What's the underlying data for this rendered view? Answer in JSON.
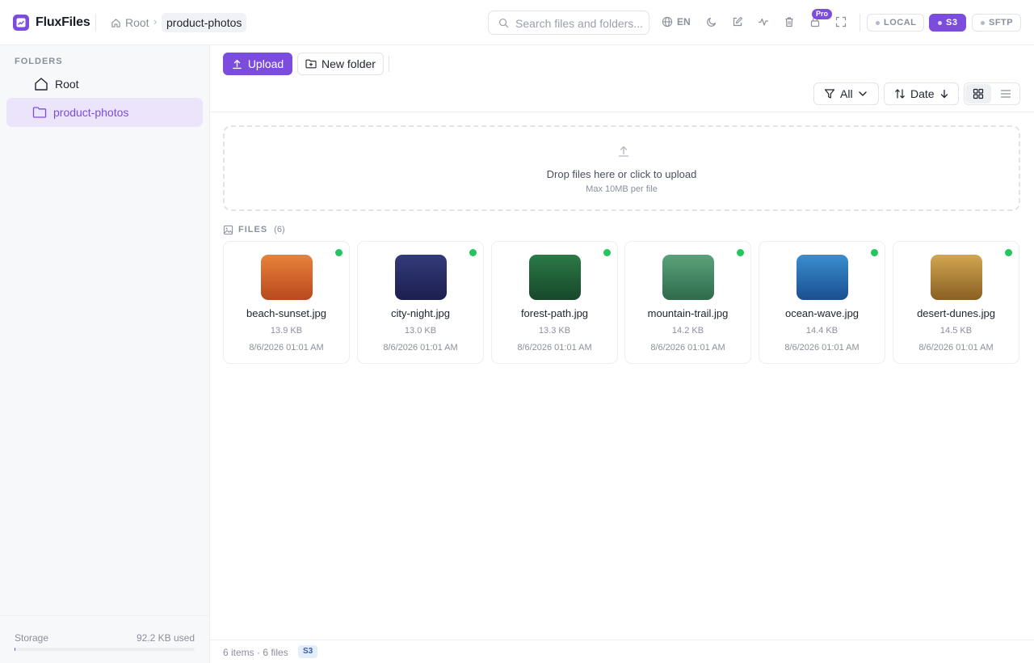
{
  "app": {
    "name": "FluxFiles",
    "accent": "#7c4ddc"
  },
  "breadcrumb": {
    "root": "Root",
    "current": "product-photos"
  },
  "search": {
    "placeholder": "Search files and folders..."
  },
  "header": {
    "language": "EN",
    "pro_badge": "Pro",
    "icons": [
      "globe-icon",
      "moon-icon",
      "edit-icon",
      "activity-icon",
      "trash-icon",
      "lock-icon",
      "fullscreen-icon"
    ],
    "storage_tabs": [
      {
        "label": "LOCAL",
        "active": false
      },
      {
        "label": "S3",
        "active": true
      },
      {
        "label": "SFTP",
        "active": false
      }
    ]
  },
  "sidebar": {
    "heading": "FOLDERS",
    "items": [
      {
        "label": "Root",
        "icon": "home-icon",
        "selected": false
      },
      {
        "label": "product-photos",
        "icon": "folder-icon",
        "selected": true
      }
    ],
    "storage_label": "Storage",
    "storage_used": "92.2 KB used",
    "storage_fill_fraction": 0.001
  },
  "toolbar": {
    "upload_label": "Upload",
    "new_folder_label": "New folder",
    "filter_label": "All",
    "sort_label": "Date",
    "view_mode": "grid"
  },
  "dropzone": {
    "title": "Drop files here or click to upload",
    "subtitle": "Max 10MB per file"
  },
  "files_section": {
    "heading": "FILES",
    "count": "(6)"
  },
  "files": [
    {
      "name": "beach-sunset.jpg",
      "size": "13.9 KB",
      "date": "8/6/2026 01:01 AM",
      "color_top": "#e8823a",
      "color_bottom": "#b84a1e",
      "synced": true
    },
    {
      "name": "city-night.jpg",
      "size": "13.0 KB",
      "date": "8/6/2026 01:01 AM",
      "color_top": "#333a7a",
      "color_bottom": "#1c1f4e",
      "synced": true
    },
    {
      "name": "forest-path.jpg",
      "size": "13.3 KB",
      "date": "8/6/2026 01:01 AM",
      "color_top": "#2b7a47",
      "color_bottom": "#17472a",
      "synced": true
    },
    {
      "name": "mountain-trail.jpg",
      "size": "14.2 KB",
      "date": "8/6/2026 01:01 AM",
      "color_top": "#5aa37b",
      "color_bottom": "#2f6a4c",
      "synced": true
    },
    {
      "name": "ocean-wave.jpg",
      "size": "14.4 KB",
      "date": "8/6/2026 01:01 AM",
      "color_top": "#3a8ed0",
      "color_bottom": "#1a4f8f",
      "synced": true
    },
    {
      "name": "desert-dunes.jpg",
      "size": "14.5 KB",
      "date": "8/6/2026 01:01 AM",
      "color_top": "#d2a651",
      "color_bottom": "#8a5f22",
      "synced": true
    }
  ],
  "statusbar": {
    "count": "6 items · 6 files",
    "storage_badge": "S3"
  }
}
